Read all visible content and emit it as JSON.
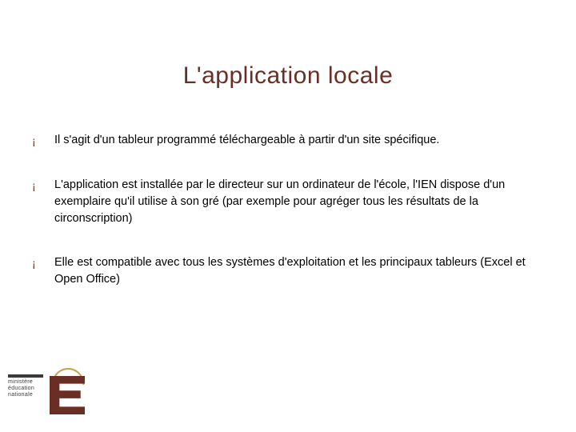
{
  "title": "L'application locale",
  "bullets": [
    "Il s'agit d'un tableur programmé téléchargeable à partir d'un site spécifique.",
    "L'application est installée par le directeur sur un ordinateur de l'école, l'IEN dispose d'un exemplaire qu'il utilise à son gré (par exemple pour agréger tous les résultats de la circonscription)",
    "Elle est compatible avec tous les systèmes d'exploitation et les principaux tableurs (Excel et Open Office)"
  ],
  "logo": {
    "line1": "ministère",
    "line2": "éducation",
    "line3": "nationale"
  },
  "bullet_char": "¡"
}
